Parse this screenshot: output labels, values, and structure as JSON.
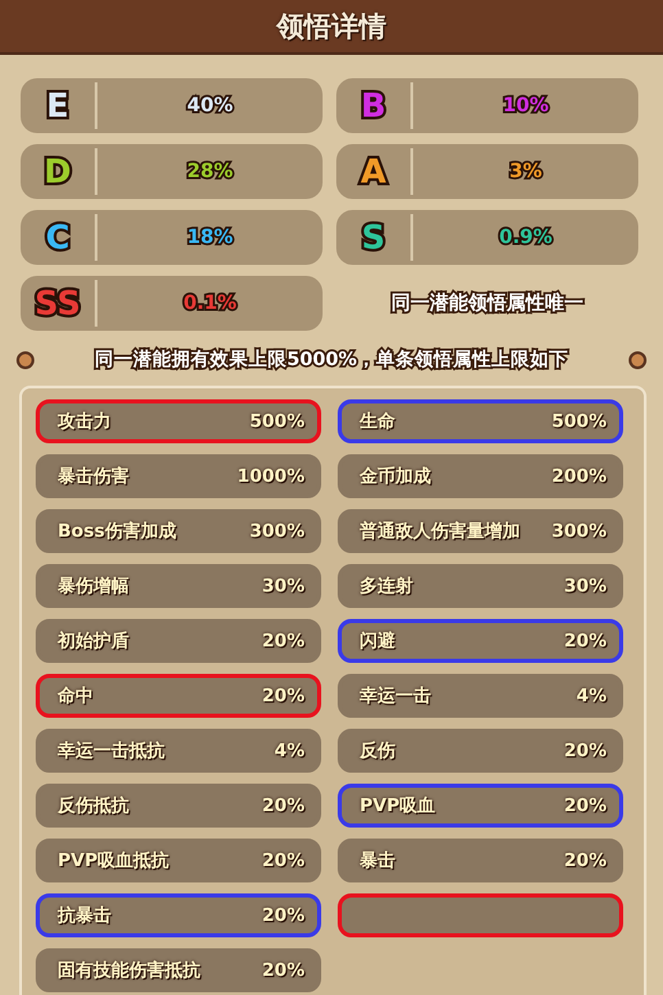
{
  "window": {
    "title": "领悟详情"
  },
  "grades": [
    {
      "grade": "E",
      "value": "40%",
      "color": "#dce8f4"
    },
    {
      "grade": "B",
      "value": "10%",
      "color": "#d02ee0"
    },
    {
      "grade": "D",
      "value": "28%",
      "color": "#9ccc2c"
    },
    {
      "grade": "A",
      "value": "3%",
      "color": "#f09a28"
    },
    {
      "grade": "C",
      "value": "18%",
      "color": "#3ab8f4"
    },
    {
      "grade": "S",
      "value": "0.9%",
      "color": "#2ec49a"
    },
    {
      "grade": "SS",
      "value": "0.1%",
      "color": "#e83a36"
    }
  ],
  "unique_note": "同一潜能领悟属性唯一",
  "limit_note": "同一潜能拥有效果上限5000%，单条领悟属性上限如下",
  "attributes": [
    {
      "label": "攻击力",
      "value": "500%",
      "color": "#e8121e"
    },
    {
      "label": "生命",
      "value": "500%",
      "color": "#3a3ae8"
    },
    {
      "label": "暴击伤害",
      "value": "1000%"
    },
    {
      "label": "金币加成",
      "value": "200%"
    },
    {
      "label": "Boss伤害加成",
      "value": "300%"
    },
    {
      "label": "普通敌人伤害量增加",
      "value": "300%"
    },
    {
      "label": "暴伤增幅",
      "value": "30%"
    },
    {
      "label": "多连射",
      "value": "30%"
    },
    {
      "label": "初始护盾",
      "value": "20%"
    },
    {
      "label": "闪避",
      "value": "20%",
      "color": "#3a3ae8"
    },
    {
      "label": "命中",
      "value": "20%",
      "color": "#e8121e"
    },
    {
      "label": "幸运一击",
      "value": "4%"
    },
    {
      "label": "幸运一击抵抗",
      "value": "4%"
    },
    {
      "label": "反伤",
      "value": "20%"
    },
    {
      "label": "反伤抵抗",
      "value": "20%"
    },
    {
      "label": "PVP吸血",
      "value": "20%",
      "color": "#3a3ae8"
    },
    {
      "label": "PVP吸血抵抗",
      "value": "20%"
    },
    {
      "label": "暴击",
      "value": "20%"
    },
    {
      "label": "抗暴击",
      "value": "20%",
      "color": "#3a3ae8"
    },
    {
      "color": "#e8121e"
    },
    {
      "label": "固有技能伤害抵抗",
      "value": "20%"
    }
  ]
}
